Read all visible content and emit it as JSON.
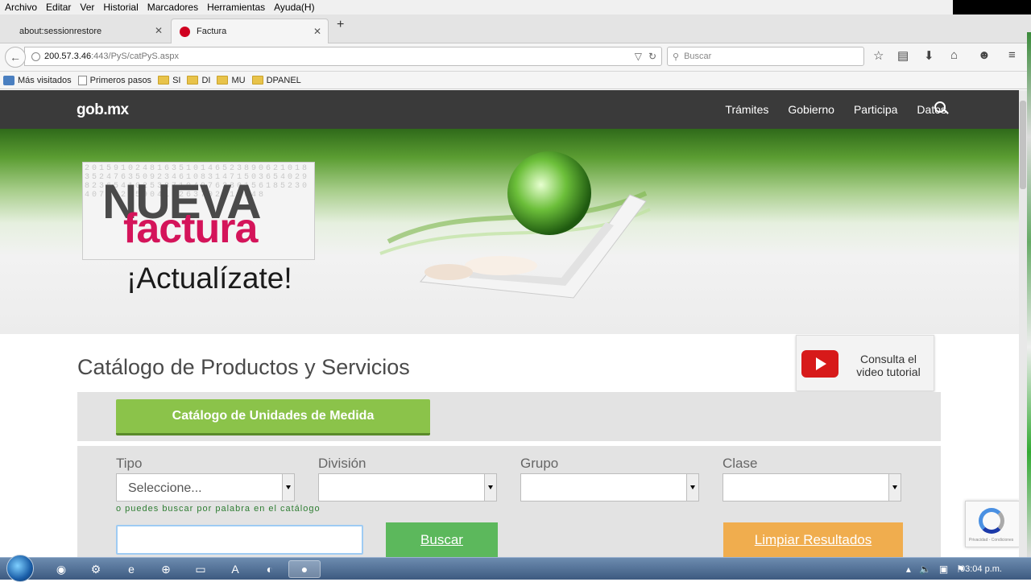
{
  "browser": {
    "menu": [
      "Archivo",
      "Editar",
      "Ver",
      "Historial",
      "Marcadores",
      "Herramientas",
      "Ayuda(H)"
    ],
    "tabs": [
      {
        "label": "about:sessionrestore"
      },
      {
        "label": "Factura"
      }
    ],
    "url_host": "200.57.3.46",
    "url_path": ":443/PyS/catPyS.aspx",
    "search_placeholder": "Buscar",
    "bookmarks": [
      "Más visitados",
      "Primeros pasos",
      "SI",
      "DI",
      "MU",
      "DPANEL"
    ]
  },
  "site": {
    "logo": "gob.mx",
    "nav": [
      "Trámites",
      "Gobierno",
      "Participa",
      "Datos"
    ]
  },
  "hero": {
    "line1": "NUEVA",
    "line2": "factura",
    "tagline": "¡Actualízate!"
  },
  "catalog": {
    "title": "Catálogo de Productos y Servicios",
    "tutorial": "Consulta el video tutorial",
    "units_button": "Catálogo de Unidades de Medida",
    "filters": [
      {
        "label": "Tipo",
        "value": "Seleccione..."
      },
      {
        "label": "División",
        "value": ""
      },
      {
        "label": "Grupo",
        "value": ""
      },
      {
        "label": "Clase",
        "value": ""
      }
    ],
    "hint": "o puedes buscar por palabra en el catálogo",
    "search_button": "Buscar",
    "clear_button": "Limpiar Resultados"
  },
  "recaptcha_text": "Privacidad - Condiciones",
  "taskbar": {
    "clock": "03:04 p.m."
  },
  "colors": {
    "gob_nav": "#3a3a3a",
    "green_button": "#8bc34a",
    "search_button": "#5cb85c",
    "clear_button": "#f0ad4e",
    "factura_red": "#d4145a"
  }
}
